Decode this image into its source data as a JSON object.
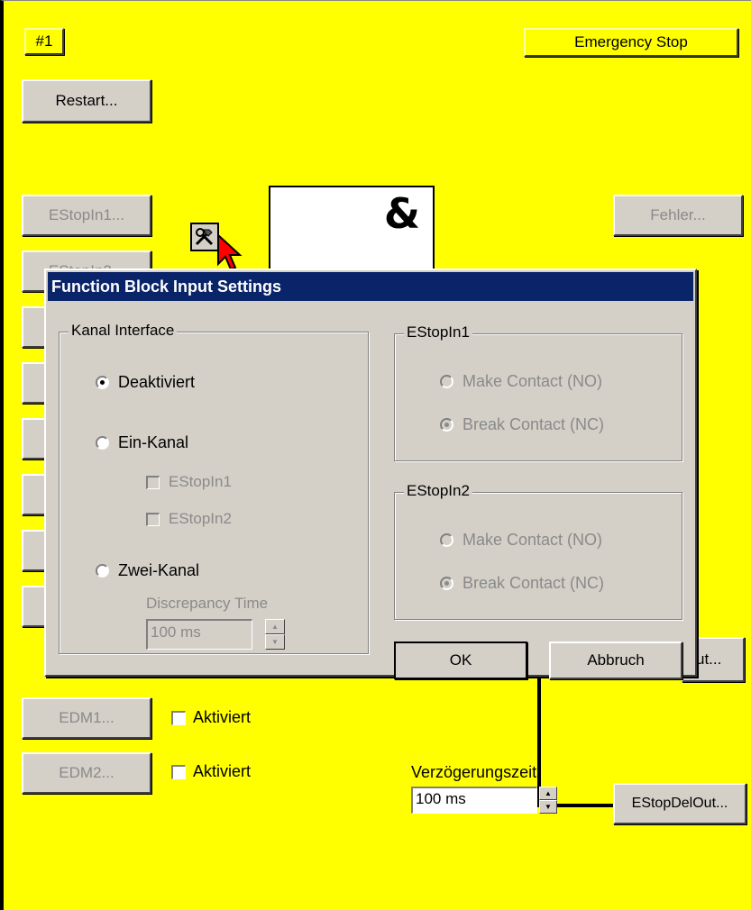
{
  "block": {
    "number_label": "#1",
    "type_label": "Emergency Stop",
    "restart_label": "Restart...",
    "estop_in1_label": "EStopIn1...",
    "estop_in2_label": "EStopIn2...",
    "fehler_label": "Fehler...",
    "and_symbol": "&",
    "output_partial_label": "ut...",
    "edm1_label": "EDM1...",
    "edm2_label": "EDM2...",
    "edm1_check_label": "Aktiviert",
    "edm2_check_label": "Aktiviert",
    "delay_label": "Verzögerungszeit",
    "delay_value": "100 ms",
    "estop_del_out_label": "EStopDelOut..."
  },
  "dialog": {
    "title": "Function Block Input Settings",
    "kanal": {
      "group_title": "Kanal Interface",
      "options": [
        "Deaktiviert",
        "Ein-Kanal",
        "Zwei-Kanal"
      ],
      "selected": "Deaktiviert",
      "ein_kanal_checks": [
        "EStopIn1",
        "EStopIn2"
      ],
      "discrepancy_label": "Discrepancy Time",
      "discrepancy_value": "100 ms"
    },
    "estop_in1": {
      "group_title": "EStopIn1",
      "make_label": "Make Contact (NO)",
      "break_label": "Break Contact (NC)",
      "selected": "Break Contact (NC)"
    },
    "estop_in2": {
      "group_title": "EStopIn2",
      "make_label": "Make Contact (NO)",
      "break_label": "Break Contact (NC)",
      "selected": "Break Contact (NC)"
    },
    "ok_label": "OK",
    "cancel_label": "Abbruch"
  },
  "colors": {
    "canvas": "#ffff00",
    "titlebar": "#0a246a",
    "dialog_face": "#d4d0c8"
  }
}
